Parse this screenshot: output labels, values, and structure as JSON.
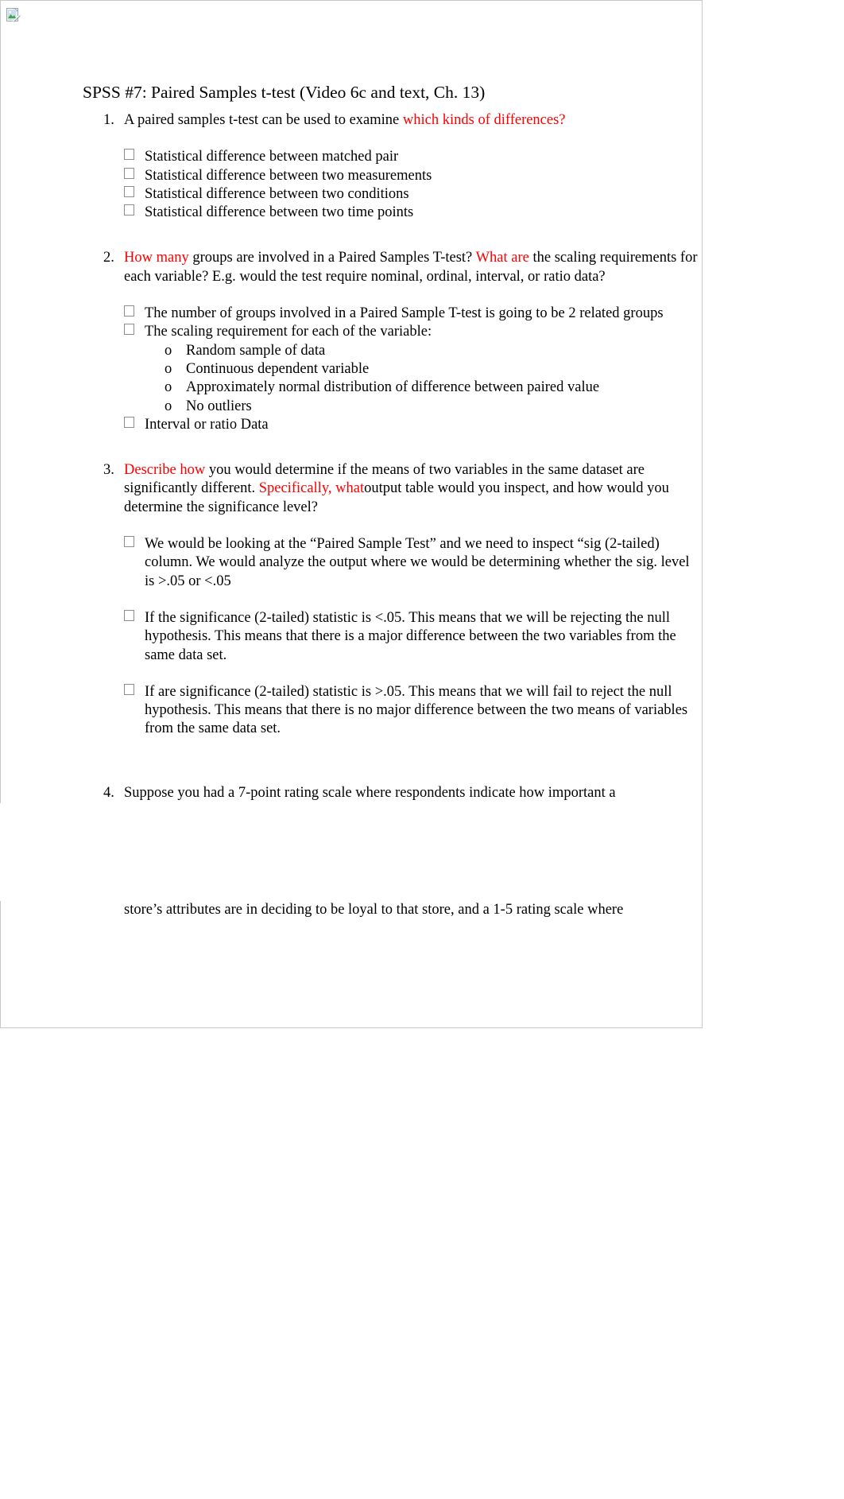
{
  "document": {
    "title": "SPSS #7: Paired Samples t-test (Video 6c and text, Ch. 13)",
    "broken_image_alt": ""
  },
  "items": [
    {
      "number": "1.",
      "text_before_red": "A paired samples t-test can be used to examine ",
      "red": " which kinds of differences?",
      "text_after_red": "",
      "bullets": [
        "Statistical difference between  matched pair",
        "Statistical difference between  two measurements",
        "Statistical difference between  two conditions",
        "Statistical difference between  two time points"
      ]
    },
    {
      "number": "2.",
      "red1": "How many",
      "mid1": " groups are involved in a Paired Samples T-test? ",
      "red2": " What are",
      "mid2": " the scaling requirements for each variable? E.g. would the test require nominal, ordinal, interval, or ratio data?",
      "bullets": [
        "The number of groups involved in a Paired Sample T-test is going to be 2 related groups",
        "The scaling requirement for each of the variable:",
        "Interval or ratio Data"
      ],
      "subbullets": [
        "Random sample of data",
        "Continuous dependent variable",
        "Approximately normal distribution of difference between paired value",
        "No outliers"
      ]
    },
    {
      "number": "3.",
      "red1": "Describe how",
      "mid1": " you would determine if the means of two variables in the same dataset are significantly different. ",
      "red2": " Specifically, what",
      "mid2": "output table would you inspect, and how would you determine the significance level?",
      "bullets": [
        "We would be looking at the  “Paired Sample Test” and we need to inspect “sig (2-tailed) column. We would analyze the output where we would be   determining whether the sig. level is >.05 or <.05",
        "If the significance (2-tailed) statistic is <.05. This means that we will be rejecting the null hypothesis. This means that there is a  major difference between the two variables from the same data set.",
        "If are significance (2-tailed) statistic is >.05. This means that we will fail to reject the null hypothesis.  This means that there is  no major difference between the two means of variables from the same data set."
      ]
    },
    {
      "number": "4.",
      "text": "Suppose you had a 7-point rating scale where respondents indicate how important a",
      "continuation": "store’s attributes are in deciding to be loyal to that store, and a 1-5 rating scale where"
    }
  ],
  "colors": {
    "red_accent": "#ff0000",
    "page_rule": "#c9c9c9",
    "text": "#000000"
  }
}
